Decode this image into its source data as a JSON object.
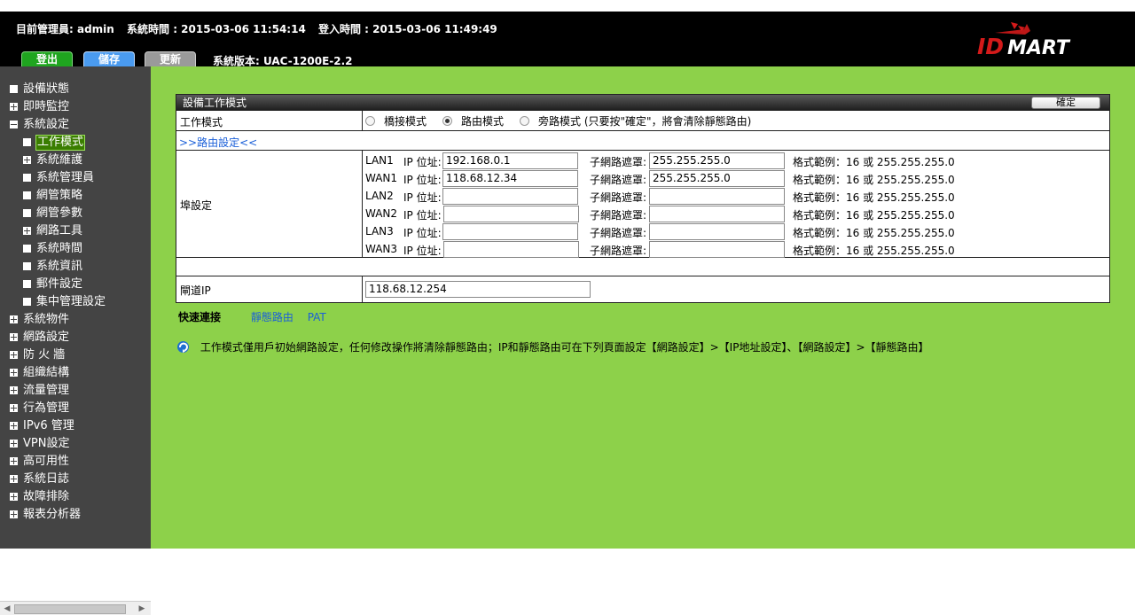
{
  "header": {
    "admin_text": "目前管理員: admin",
    "system_time_text": "系統時間 : 2015-03-06 11:54:14",
    "login_time_text": "登入時間 : 2015-03-06 11:49:49",
    "buttons": {
      "logout": "登出",
      "save": "儲存",
      "update": "更新"
    },
    "version_text": "系統版本: UAC-1200E-2.2",
    "logo_text": "IDMART"
  },
  "sidebar": {
    "items": [
      {
        "label": "設備狀態",
        "level": 0,
        "icon": "square"
      },
      {
        "label": "即時監控",
        "level": 0,
        "icon": "plus"
      },
      {
        "label": "系統設定",
        "level": 0,
        "icon": "minus"
      },
      {
        "label": "工作模式",
        "level": 1,
        "icon": "square",
        "active": true
      },
      {
        "label": "系統維護",
        "level": 1,
        "icon": "plus"
      },
      {
        "label": "系統管理員",
        "level": 1,
        "icon": "square"
      },
      {
        "label": "網管策略",
        "level": 1,
        "icon": "square"
      },
      {
        "label": "網管參數",
        "level": 1,
        "icon": "square"
      },
      {
        "label": "網路工具",
        "level": 1,
        "icon": "plus"
      },
      {
        "label": "系統時間",
        "level": 1,
        "icon": "square"
      },
      {
        "label": "系統資訊",
        "level": 1,
        "icon": "square"
      },
      {
        "label": "郵件設定",
        "level": 1,
        "icon": "square"
      },
      {
        "label": "集中管理設定",
        "level": 1,
        "icon": "square"
      },
      {
        "label": "系統物件",
        "level": 0,
        "icon": "plus"
      },
      {
        "label": "網路設定",
        "level": 0,
        "icon": "plus"
      },
      {
        "label": "防 火 牆",
        "level": 0,
        "icon": "plus"
      },
      {
        "label": "組織結構",
        "level": 0,
        "icon": "plus"
      },
      {
        "label": "流量管理",
        "level": 0,
        "icon": "plus"
      },
      {
        "label": "行為管理",
        "level": 0,
        "icon": "plus"
      },
      {
        "label": "IPv6 管理",
        "level": 0,
        "icon": "plus"
      },
      {
        "label": "VPN設定",
        "level": 0,
        "icon": "plus"
      },
      {
        "label": "高可用性",
        "level": 0,
        "icon": "plus"
      },
      {
        "label": "系統日誌",
        "level": 0,
        "icon": "plus"
      },
      {
        "label": "故障排除",
        "level": 0,
        "icon": "plus"
      },
      {
        "label": "報表分析器",
        "level": 0,
        "icon": "plus"
      }
    ]
  },
  "panel": {
    "title": "設備工作模式",
    "confirm_label": "確定",
    "mode_label": "工作模式",
    "modes": [
      {
        "label": "橋接模式",
        "selected": false
      },
      {
        "label": "路由模式",
        "selected": true
      },
      {
        "label": "旁路模式 (只要按\"確定\"，將會清除靜態路由)",
        "selected": false
      }
    ],
    "route_link": ">>路由設定<<",
    "port_label": "埠設定",
    "ip_label": "IP 位址:",
    "mask_label": "子網路遮罩:",
    "format_hint": "格式範例：16 或 255.255.255.0",
    "ports": [
      {
        "name": "LAN1",
        "ip": "192.168.0.1",
        "mask": "255.255.255.0"
      },
      {
        "name": "WAN1",
        "ip": "118.68.12.34",
        "mask": "255.255.255.0"
      },
      {
        "name": "LAN2",
        "ip": "",
        "mask": ""
      },
      {
        "name": "WAN2",
        "ip": "",
        "mask": ""
      },
      {
        "name": "LAN3",
        "ip": "",
        "mask": ""
      },
      {
        "name": "WAN3",
        "ip": "",
        "mask": ""
      }
    ],
    "gateway_label": "閘道IP",
    "gateway_value": "118.68.12.254"
  },
  "quick": {
    "label": "快速連接",
    "links": [
      "靜態路由",
      "PAT"
    ]
  },
  "note": "工作模式僅用戶初始網路設定，任何修改操作將清除靜態路由；IP和靜態路由可在下列頁面設定【網路設定】>【IP地址設定】、【網路設定】>【靜態路由】",
  "colors": {
    "content_bg": "#8dd14a",
    "sidebar_bg": "#444444",
    "header_bg": "#000000",
    "link": "#1a5fd8"
  }
}
